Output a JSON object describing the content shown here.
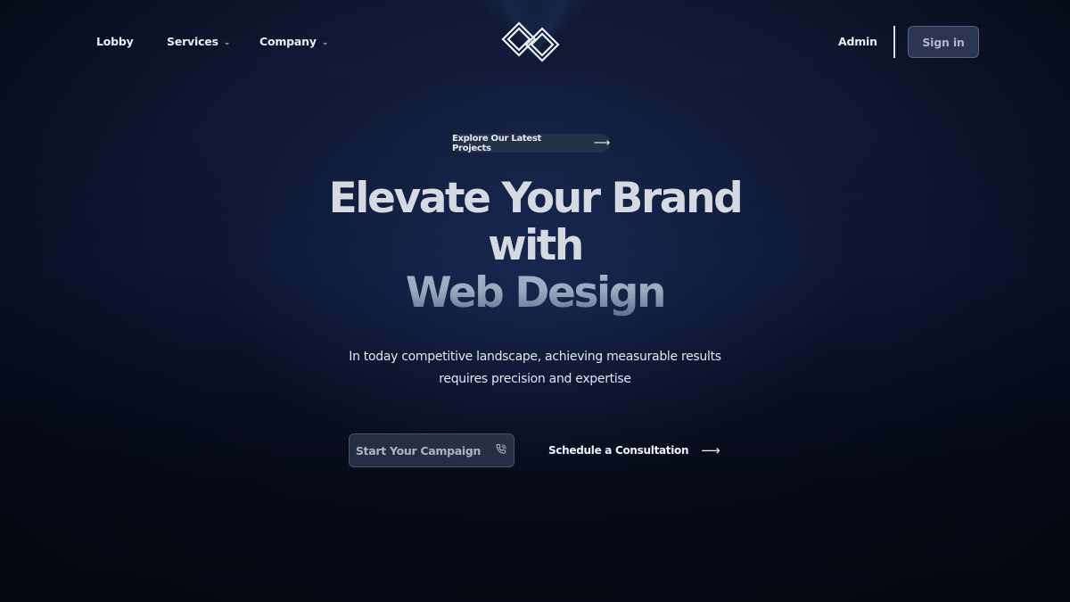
{
  "nav": {
    "lobby": "Lobby",
    "services": "Services",
    "company": "Company",
    "admin": "Admin",
    "sign_in": "Sign in",
    "chevron_icon": "chevron-down-icon",
    "logo_icon": "interlocked-diamond-logo"
  },
  "hero": {
    "pill_label": "Explore Our Latest Projects",
    "pill_arrow": "⟶",
    "headline_line1": "Elevate Your Brand",
    "headline_line2": "with",
    "headline_line3": "Web Design",
    "subtitle_line1": "In today competitive landscape, achieving measurable results",
    "subtitle_line2": "requires precision and expertise",
    "primary_cta": "Start Your Campaign",
    "primary_cta_icon": "phone-icon",
    "secondary_cta": "Schedule a Consultation",
    "secondary_cta_arrow": "⟶"
  },
  "colors": {
    "background": "#070b18",
    "accent_gradient_top": "#a9b3c7",
    "accent_gradient_bottom": "#5d6d8c",
    "button_fill": "#38445e"
  }
}
